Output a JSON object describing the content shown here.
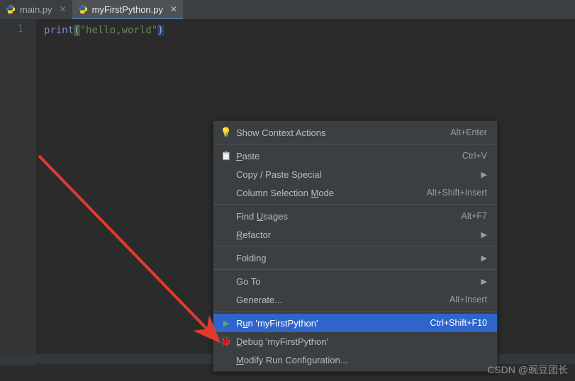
{
  "tabs": [
    {
      "label": "main.py",
      "active": false
    },
    {
      "label": "myFirstPython.py",
      "active": true
    }
  ],
  "editor": {
    "lineNumbers": [
      "1"
    ],
    "code": {
      "fn": "print",
      "open": "(",
      "str": "\"hello,world\"",
      "close": ")"
    }
  },
  "menu": {
    "items": [
      {
        "icon": "bulb",
        "label": "Show Context Actions",
        "shortcut": "Alt+Enter"
      },
      {
        "sep": true
      },
      {
        "icon": "paste",
        "label": "Paste",
        "mn": "P",
        "shortcut": "Ctrl+V"
      },
      {
        "label": "Copy / Paste Special",
        "submenu": true
      },
      {
        "label": "Column Selection Mode",
        "mn": "M",
        "shortcut": "Alt+Shift+Insert"
      },
      {
        "sep": true
      },
      {
        "label": "Find Usages",
        "mn": "U",
        "shortcut": "Alt+F7"
      },
      {
        "label": "Refactor",
        "mn": "R",
        "submenu": true
      },
      {
        "sep": true
      },
      {
        "label": "Folding",
        "submenu": true
      },
      {
        "sep": true
      },
      {
        "label": "Go To",
        "submenu": true
      },
      {
        "label": "Generate...",
        "shortcut": "Alt+Insert"
      },
      {
        "sep": true
      },
      {
        "icon": "run",
        "label": "Run 'myFirstPython'",
        "mn": "u",
        "shortcut": "Ctrl+Shift+F10",
        "selected": true
      },
      {
        "icon": "bug",
        "label": "Debug 'myFirstPython'",
        "mn": "D"
      },
      {
        "label": "Modify Run Configuration...",
        "mn": "M"
      }
    ]
  },
  "watermark": "CSDN @豌豆团长"
}
